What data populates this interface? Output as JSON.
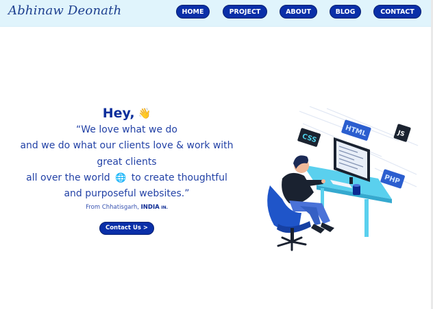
{
  "header": {
    "logo": "Abhinaw Deonath",
    "nav": [
      "HOME",
      "PROJECT",
      "ABOUT",
      "BLOG",
      "CONTACT"
    ]
  },
  "hero": {
    "greeting": "Hey,",
    "wave": "👋",
    "line1": "“We love what we do",
    "line2": "and we do what our clients love & work with",
    "line3": "great clients",
    "line4a": "all over the world",
    "globe": "🌐",
    "line4b": "to create thoughtful",
    "line5": "and purposeful websites.”",
    "from_prefix": "From Chhatisgarh,",
    "from_country": "INDIA",
    "from_code": "IN.",
    "cta": "Contact Us >"
  },
  "illustration": {
    "tags": [
      "CSS",
      "HTML",
      "JS",
      "PHP"
    ]
  },
  "colors": {
    "accent": "#0a2fa8",
    "header_bg": "#e0f4fc",
    "text": "#1e3c9e"
  }
}
